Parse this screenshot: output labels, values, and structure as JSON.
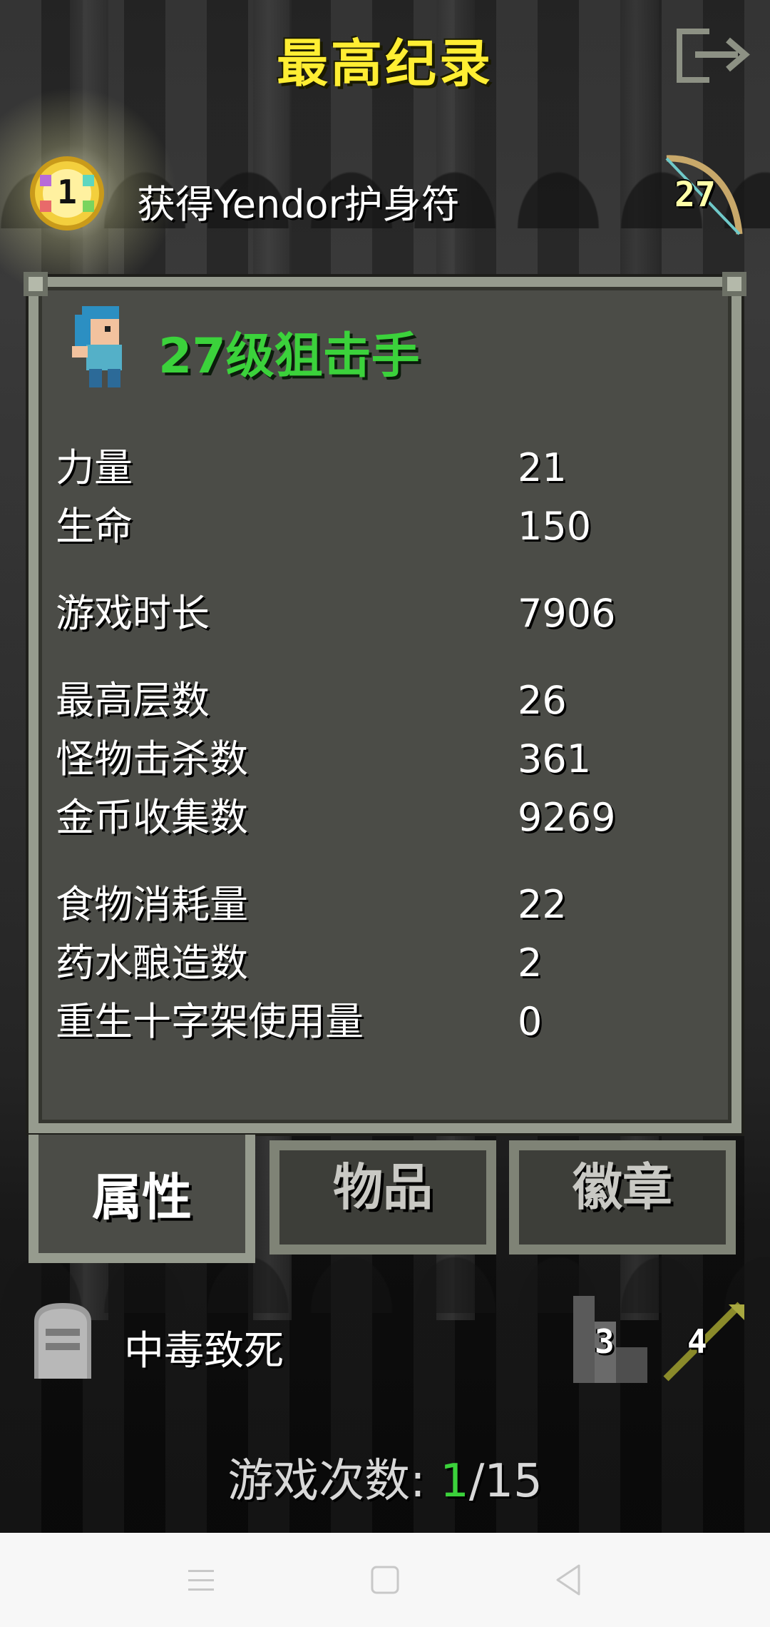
{
  "header": {
    "title": "最高纪录",
    "exit_icon": "exit-icon"
  },
  "record": {
    "rank": "1",
    "description": "获得Yendor护身符",
    "level": "27",
    "rank_icon": "gold-medal-icon",
    "level_icon": "bow-icon"
  },
  "hero": {
    "title": "27级狙击手",
    "avatar_icon": "huntress-avatar-icon"
  },
  "stats": [
    {
      "label": "力量",
      "value": "21"
    },
    {
      "label": "生命",
      "value": "150"
    },
    {
      "label": "游戏时长",
      "value": "7906"
    },
    {
      "label": "最高层数",
      "value": "26"
    },
    {
      "label": "怪物击杀数",
      "value": "361"
    },
    {
      "label": "金币收集数",
      "value": "9269"
    },
    {
      "label": "食物消耗量",
      "value": "22"
    },
    {
      "label": "药水酿造数",
      "value": "2"
    },
    {
      "label": "重生十字架使用量",
      "value": "0"
    }
  ],
  "tabs": [
    {
      "label": "属性",
      "active": true
    },
    {
      "label": "物品",
      "active": false
    },
    {
      "label": "徽章",
      "active": false
    }
  ],
  "footer": {
    "death_cause": "中毒致死",
    "depth": "3",
    "weapon_level": "4",
    "game_count_label": "游戏次数:",
    "game_count_current": "1",
    "game_count_total": "/15"
  },
  "colors": {
    "title_yellow": "#ffee33",
    "hero_green": "#3bd23b",
    "panel_bg": "#4b4c47",
    "panel_border": "#969b8e"
  }
}
